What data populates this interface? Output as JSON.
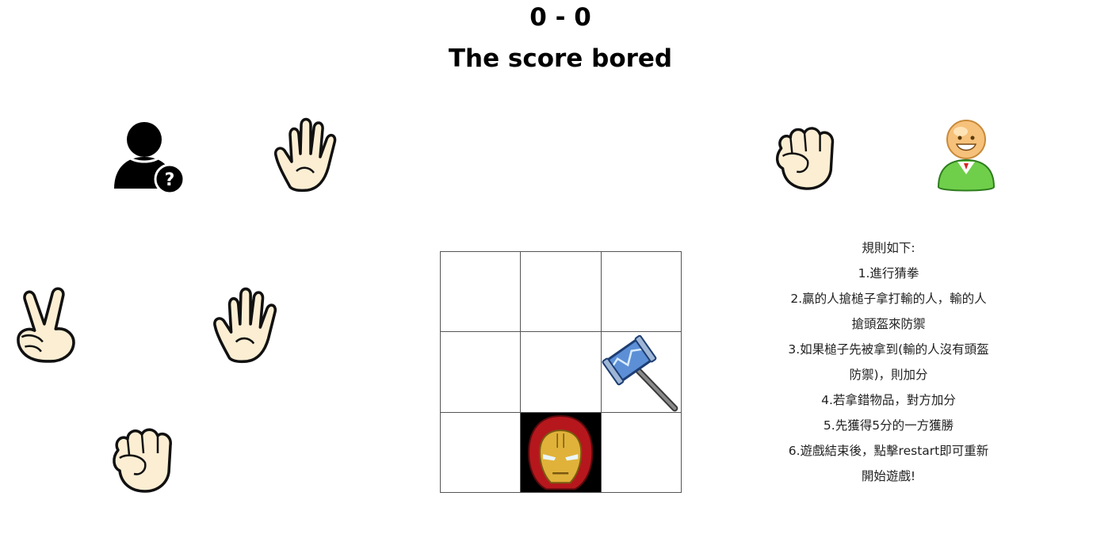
{
  "scoreboard": {
    "score": "0 - 0",
    "title": "The score bored"
  },
  "players": {
    "left": {
      "avatar_icon": "unknown-user-icon",
      "current_hand_icon": "hand-paper-icon"
    },
    "right": {
      "avatar_icon": "smiling-user-icon",
      "current_hand_icon": "hand-rock-icon"
    }
  },
  "choices": [
    {
      "name": "scissors",
      "icon": "hand-scissors-icon"
    },
    {
      "name": "paper",
      "icon": "hand-paper-icon"
    },
    {
      "name": "rock",
      "icon": "hand-rock-icon"
    }
  ],
  "board": {
    "rows": 3,
    "cols": 3,
    "cells": [
      {
        "content": ""
      },
      {
        "content": ""
      },
      {
        "content": ""
      },
      {
        "content": ""
      },
      {
        "content": ""
      },
      {
        "content": "hammer-icon"
      },
      {
        "content": ""
      },
      {
        "content": "iron-man-helmet-icon"
      },
      {
        "content": ""
      }
    ]
  },
  "rules": {
    "lines": [
      "規則如下:",
      "1.進行猜拳",
      "2.贏的人搶槌子拿打輸的人，輸的人",
      "搶頭盔來防禦",
      "3.如果槌子先被拿到(輸的人沒有頭盔",
      "防禦)，則加分",
      "4.若拿錯物品，對方加分",
      "5.先獲得5分的一方獲勝",
      "6.遊戲結束後，點擊restart即可重新",
      "開始遊戲!"
    ]
  },
  "colors": {
    "skin": "#fbeed3",
    "outline": "#111111",
    "avatar_green": "#6fcf4a",
    "hammer_blue": "#5c8fd6"
  }
}
